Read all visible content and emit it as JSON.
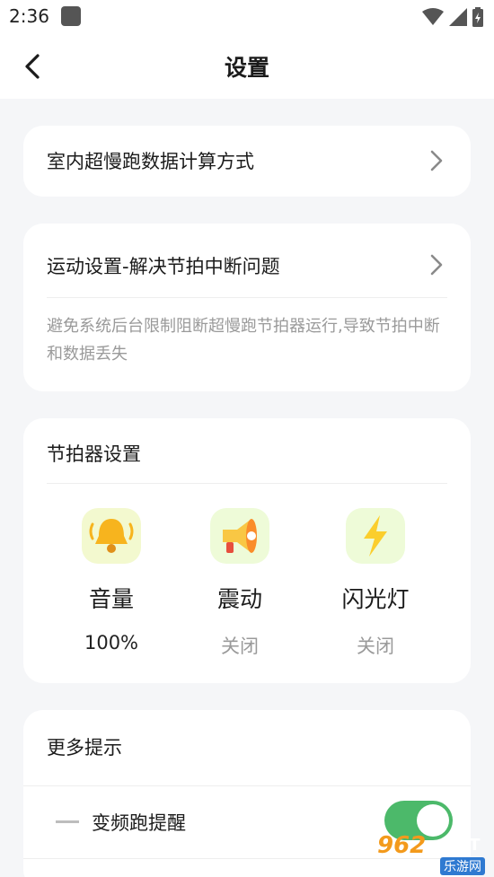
{
  "status_bar": {
    "time": "2:36"
  },
  "header": {
    "title": "设置"
  },
  "card1": {
    "title": "室内超慢跑数据计算方式"
  },
  "card2": {
    "title": "运动设置-解决节拍中断问题",
    "description": "避免系统后台限制阻断超慢跑节拍器运行,导致节拍中断和数据丢失"
  },
  "metronome": {
    "title": "节拍器设置",
    "items": [
      {
        "label": "音量",
        "value": "100%",
        "icon": "bell-icon"
      },
      {
        "label": "震动",
        "value": "关闭",
        "icon": "megaphone-icon"
      },
      {
        "label": "闪光灯",
        "value": "关闭",
        "icon": "lightning-icon"
      }
    ]
  },
  "more_tips": {
    "title": "更多提示",
    "items": [
      {
        "label": "变频跑提醒",
        "enabled": true
      }
    ]
  },
  "watermark": {
    "number": "962",
    "net": ".NET",
    "cn": "乐游网"
  },
  "colors": {
    "accent_green": "#4cb96a",
    "value_dark": "#222222",
    "value_gray": "#9a9a9a"
  }
}
